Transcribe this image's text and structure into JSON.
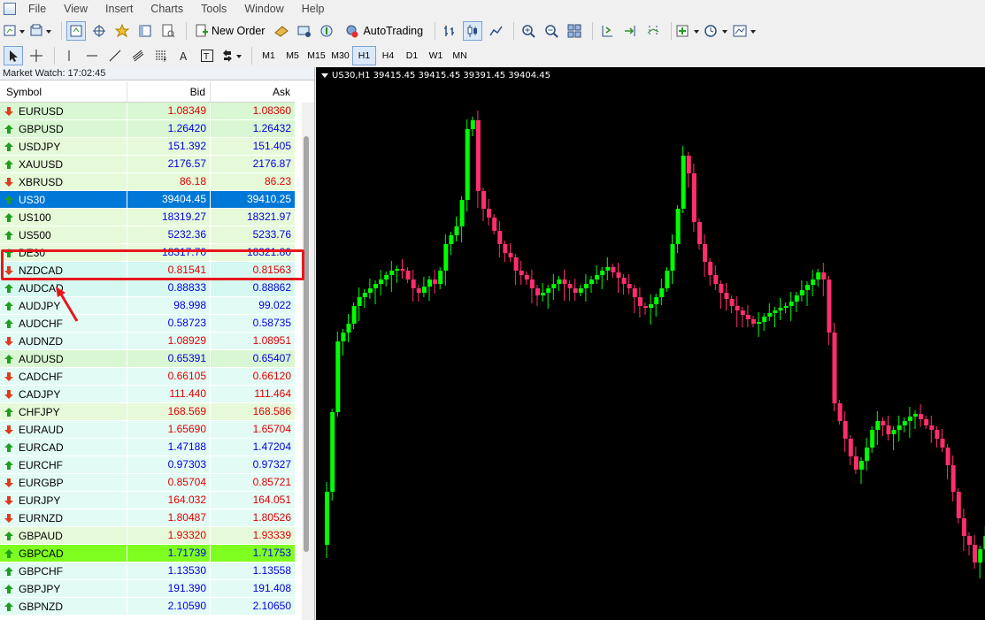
{
  "menu": [
    "File",
    "View",
    "Insert",
    "Charts",
    "Tools",
    "Window",
    "Help"
  ],
  "toolbar": {
    "new_order_label": "New Order",
    "autotrading_label": "AutoTrading",
    "timeframes": [
      "M1",
      "M5",
      "M15",
      "M30",
      "H1",
      "H4",
      "D1",
      "W1",
      "MN"
    ],
    "selected_timeframe": "H1"
  },
  "market_watch": {
    "title": "Market Watch: 17:02:45",
    "columns": {
      "symbol": "Symbol",
      "bid": "Bid",
      "ask": "Ask"
    },
    "rows": [
      {
        "symbol": "EURUSD",
        "bid": "1.08349",
        "ask": "1.08360",
        "dir": "down",
        "color": "red",
        "bg": "#d9f7d2"
      },
      {
        "symbol": "GBPUSD",
        "bid": "1.26420",
        "ask": "1.26432",
        "dir": "up",
        "color": "blue",
        "bg": "#d9f7d2"
      },
      {
        "symbol": "USDJPY",
        "bid": "151.392",
        "ask": "151.405",
        "dir": "up",
        "color": "blue",
        "bg": "#e6fad9"
      },
      {
        "symbol": "XAUUSD",
        "bid": "2176.57",
        "ask": "2176.87",
        "dir": "up",
        "color": "blue",
        "bg": "#e6fad9"
      },
      {
        "symbol": "XBRUSD",
        "bid": "86.18",
        "ask": "86.23",
        "dir": "down",
        "color": "red",
        "bg": "#e6fad9"
      },
      {
        "symbol": "US30",
        "bid": "39404.45",
        "ask": "39410.25",
        "dir": "up",
        "color": "white",
        "bg": "#0078d7",
        "selected": true
      },
      {
        "symbol": "US100",
        "bid": "18319.27",
        "ask": "18321.97",
        "dir": "up",
        "color": "blue",
        "bg": "#e6fad9"
      },
      {
        "symbol": "US500",
        "bid": "5232.36",
        "ask": "5233.76",
        "dir": "up",
        "color": "blue",
        "bg": "#e6fad9"
      },
      {
        "symbol": "DE30",
        "bid": "18317.70",
        "ask": "18321.80",
        "dir": "up",
        "color": "blue",
        "bg": "#e6fad9"
      },
      {
        "symbol": "NZDCAD",
        "bid": "0.81541",
        "ask": "0.81563",
        "dir": "down",
        "color": "red",
        "bg": "#d5f9f0"
      },
      {
        "symbol": "AUDCAD",
        "bid": "0.88833",
        "ask": "0.88862",
        "dir": "up",
        "color": "blue",
        "bg": "#d5f9f0"
      },
      {
        "symbol": "AUDJPY",
        "bid": "98.998",
        "ask": "99.022",
        "dir": "up",
        "color": "blue",
        "bg": "#e3fbf5"
      },
      {
        "symbol": "AUDCHF",
        "bid": "0.58723",
        "ask": "0.58735",
        "dir": "up",
        "color": "blue",
        "bg": "#e3fbf5"
      },
      {
        "symbol": "AUDNZD",
        "bid": "1.08929",
        "ask": "1.08951",
        "dir": "down",
        "color": "red",
        "bg": "#e3fbf5"
      },
      {
        "symbol": "AUDUSD",
        "bid": "0.65391",
        "ask": "0.65407",
        "dir": "up",
        "color": "blue",
        "bg": "#d9f7d2"
      },
      {
        "symbol": "CADCHF",
        "bid": "0.66105",
        "ask": "0.66120",
        "dir": "down",
        "color": "red",
        "bg": "#e3fbf5"
      },
      {
        "symbol": "CADJPY",
        "bid": "111.440",
        "ask": "111.464",
        "dir": "down",
        "color": "red",
        "bg": "#e3fbf5"
      },
      {
        "symbol": "CHFJPY",
        "bid": "168.569",
        "ask": "168.586",
        "dir": "up",
        "color": "red",
        "bg": "#e6fad9"
      },
      {
        "symbol": "EURAUD",
        "bid": "1.65690",
        "ask": "1.65704",
        "dir": "down",
        "color": "red",
        "bg": "#e3fbf5"
      },
      {
        "symbol": "EURCAD",
        "bid": "1.47188",
        "ask": "1.47204",
        "dir": "up",
        "color": "blue",
        "bg": "#e3fbf5"
      },
      {
        "symbol": "EURCHF",
        "bid": "0.97303",
        "ask": "0.97327",
        "dir": "up",
        "color": "blue",
        "bg": "#e3fbf5"
      },
      {
        "symbol": "EURGBP",
        "bid": "0.85704",
        "ask": "0.85721",
        "dir": "down",
        "color": "red",
        "bg": "#e3fbf5"
      },
      {
        "symbol": "EURJPY",
        "bid": "164.032",
        "ask": "164.051",
        "dir": "down",
        "color": "red",
        "bg": "#e3fbf5"
      },
      {
        "symbol": "EURNZD",
        "bid": "1.80487",
        "ask": "1.80526",
        "dir": "down",
        "color": "red",
        "bg": "#e3fbf5"
      },
      {
        "symbol": "GBPAUD",
        "bid": "1.93320",
        "ask": "1.93339",
        "dir": "up",
        "color": "red",
        "bg": "#e6fad9"
      },
      {
        "symbol": "GBPCAD",
        "bid": "1.71739",
        "ask": "1.71753",
        "dir": "up",
        "color": "blue",
        "bg": "#7fff1f"
      },
      {
        "symbol": "GBPCHF",
        "bid": "1.13530",
        "ask": "1.13558",
        "dir": "up",
        "color": "blue",
        "bg": "#e3fbf5"
      },
      {
        "symbol": "GBPJPY",
        "bid": "191.390",
        "ask": "191.408",
        "dir": "up",
        "color": "blue",
        "bg": "#e3fbf5"
      },
      {
        "symbol": "GBPNZD",
        "bid": "2.10590",
        "ask": "2.10650",
        "dir": "up",
        "color": "blue",
        "bg": "#e3fbf5"
      }
    ]
  },
  "chart": {
    "header": "US30,H1  39415.45 39415.45 39391.45 39404.45",
    "bull_color": "#00ff00",
    "bear_color": "#ff2f6d",
    "background": "#000000"
  },
  "colors": {
    "red": "#e00000",
    "blue": "#0000e0",
    "white": "#ffffff",
    "highlight": "#e8161c"
  }
}
